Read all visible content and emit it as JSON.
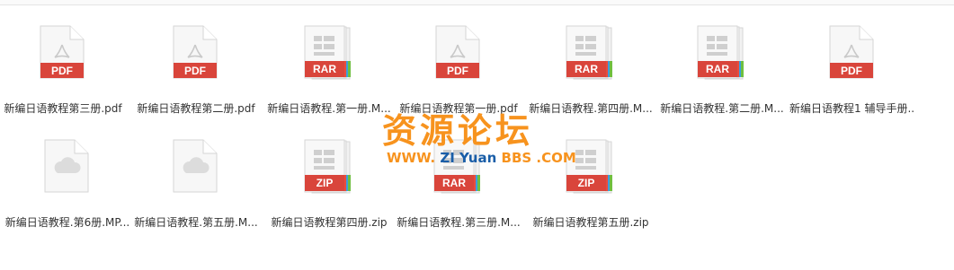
{
  "colors": {
    "pdf": "#d9453b",
    "rar": "#d9453b",
    "zip": "#d9453b",
    "rar_stripes": [
      "#e84c3d",
      "#3b9ede",
      "#6fbf40"
    ],
    "watermark_orange": "#f7931e",
    "watermark_blue": "#1a5ea8"
  },
  "files": [
    {
      "name": "新编日语教程第三册.pdf",
      "type": "pdf",
      "badge": "PDF",
      "icon": "pdf-icon"
    },
    {
      "name": "新编日语教程第二册.pdf",
      "type": "pdf",
      "badge": "PDF",
      "icon": "pdf-icon"
    },
    {
      "name": "新编日语教程.第一册.M...",
      "type": "rar",
      "badge": "RAR",
      "icon": "rar-icon"
    },
    {
      "name": "新编日语教程第一册.pdf",
      "type": "pdf",
      "badge": "PDF",
      "icon": "pdf-icon"
    },
    {
      "name": "新编日语教程.第四册.M...",
      "type": "rar",
      "badge": "RAR",
      "icon": "rar-icon"
    },
    {
      "name": "新编日语教程.第二册.M...",
      "type": "rar",
      "badge": "RAR",
      "icon": "rar-icon"
    },
    {
      "name": "新编日语教程1 辅导手册...",
      "type": "pdf",
      "badge": "PDF",
      "icon": "pdf-icon"
    },
    {
      "name": "新编日语教程.第6册.MP...",
      "type": "cloud",
      "badge": "",
      "icon": "cloud-file-icon"
    },
    {
      "name": "新编日语教程.第五册.M...",
      "type": "cloud",
      "badge": "",
      "icon": "cloud-file-icon"
    },
    {
      "name": "新编日语教程第四册.zip",
      "type": "zip",
      "badge": "ZIP",
      "icon": "zip-icon"
    },
    {
      "name": "新编日语教程.第三册.M...",
      "type": "rar",
      "badge": "RAR",
      "icon": "rar-icon"
    },
    {
      "name": "新编日语教程第五册.zip",
      "type": "zip",
      "badge": "ZIP",
      "icon": "zip-icon"
    }
  ],
  "watermark": {
    "title": "资源论坛",
    "www": "WWW.",
    "zi": " ZI",
    "yuan": " Yuan",
    "bbs": " BBS",
    "com": " .COM"
  }
}
